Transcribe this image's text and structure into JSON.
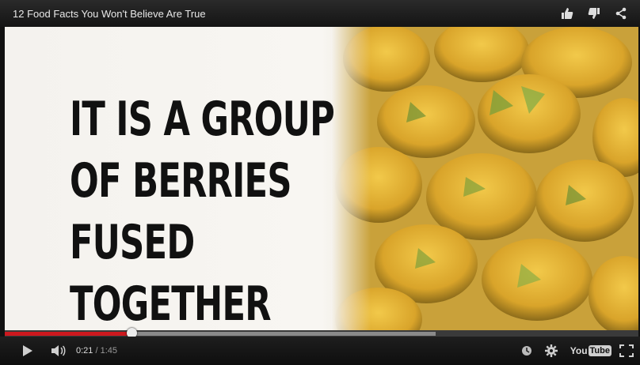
{
  "header": {
    "title": "12 Food Facts You Won't Believe Are True"
  },
  "icons": {
    "like": "thumbs-up-icon",
    "dislike": "thumbs-down-icon",
    "share": "share-icon",
    "play": "play-icon",
    "volume": "volume-icon",
    "watch_later": "clock-icon",
    "settings": "gear-icon",
    "fullscreen": "fullscreen-icon"
  },
  "video": {
    "caption_lines": [
      "IT IS A GROUP",
      "OF BERRIES",
      "FUSED",
      "TOGETHER"
    ]
  },
  "player": {
    "current_time": "0:21",
    "separator": " / ",
    "duration": "1:45",
    "progress_fraction": 0.2,
    "buffered_fraction": 0.68,
    "logo_text_you": "You",
    "logo_text_tube": "Tube"
  },
  "colors": {
    "progress_played": "#cc181e",
    "progress_buffered": "#8a8a8a",
    "bar_bg": "#1e1e1e",
    "accent_text": "#e8e8e8"
  }
}
